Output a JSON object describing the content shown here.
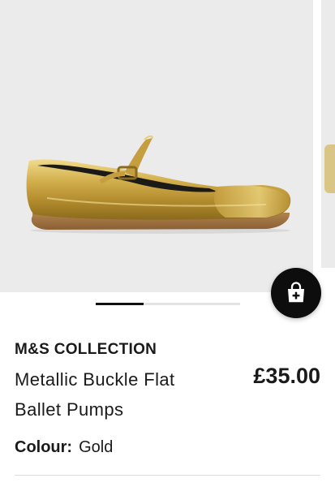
{
  "product": {
    "brand": "M&S COLLECTION",
    "title": "Metallic Buckle Flat Ballet Pumps",
    "price": "£35.00",
    "colour_label": "Colour:",
    "colour_value": "Gold"
  },
  "gallery": {
    "image_alt": "Gold metallic Mary Jane ballet flat with buckle strap",
    "active_index": 1,
    "slide_count": 3
  },
  "actions": {
    "add_to_bag_icon": "shopping-bag-plus-icon"
  },
  "colors": {
    "gold": "#c9a94a",
    "fab_background": "#0d0d0d",
    "image_background": "#ebebeb"
  }
}
